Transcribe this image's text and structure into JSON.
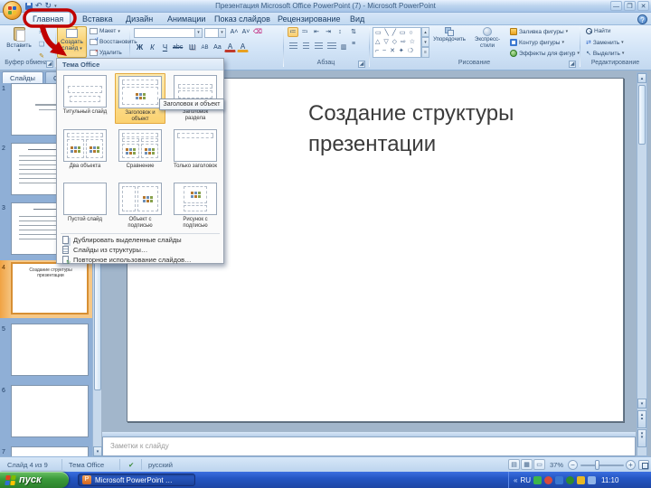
{
  "colors": {
    "annotation_red": "#c00000",
    "selection_orange": "#f0a344",
    "highlight_orange": "#fbd271",
    "taskbar_blue": "#2456c4",
    "start_green": "#3a9a3a"
  },
  "icons": {
    "caret": "▾",
    "scissors": "✂",
    "copy": "❏",
    "format_painter": "✎",
    "undo": "↶",
    "redo": "↻",
    "help": "?",
    "up": "▴",
    "down": "▾",
    "check": "✔",
    "minimize": "—",
    "maximize": "❐",
    "close": "✕",
    "chevron": "«",
    "minus": "−",
    "plus": "+"
  },
  "titlebar": {
    "title": "Презентация Microsoft Office PowerPoint (7) - Microsoft PowerPoint"
  },
  "tabs": {
    "home": "Главная",
    "insert": "Вставка",
    "design": "Дизайн",
    "animations": "Анимации",
    "slideshow": "Показ слайдов",
    "review": "Рецензирование",
    "view": "Вид"
  },
  "ribbon": {
    "paste": "Вставить",
    "clipboard_group": "Буфер обмена",
    "new_slide_1": "Создать",
    "new_slide_2": "слайд",
    "layout": "Макет",
    "reset": "Восстановить",
    "delete": "Удалить",
    "bold": "Ж",
    "italic": "К",
    "underline": "Ч",
    "strike": "abc",
    "shadow": "Ш",
    "spacing": "АВ",
    "case": "Аа",
    "fontcolor": "А",
    "paragraph_group": "Абзац",
    "shapes_row1": "▭ ╲ ╱ ▭ ○",
    "shapes_row2": "△ ▽ ◇ ⇨ ☆",
    "shapes_row3": "⌐ ~ ✕ ✦ ❍",
    "arrange": "Упорядочить",
    "quick_styles": "Экспресс-стили",
    "shape_fill": "Заливка фигуры",
    "shape_outline": "Контур фигуры",
    "shape_effects": "Эффекты для фигур",
    "drawing_group": "Рисование",
    "find": "Найти",
    "replace": "Заменить",
    "select": "Выделить",
    "editing_group": "Редактирование"
  },
  "layout_menu": {
    "header": "Тема Office",
    "tooltip": "Заголовок и объект",
    "layouts": [
      "Титульный слайд",
      "Заголовок и объект",
      "Заголовок раздела",
      "Два объекта",
      "Сравнение",
      "Только заголовок",
      "Пустой слайд",
      "Объект с подписью",
      "Рисунок с подписью"
    ],
    "duplicate": "Дублировать выделенные слайды",
    "from_outline": "Слайды из структуры…",
    "reuse": "Повторное использование слайдов…"
  },
  "slides_pane": {
    "tab_slides": "Слайды",
    "tab_outline": "Структура",
    "numbers": [
      "1",
      "2",
      "3",
      "4",
      "5",
      "6",
      "7"
    ],
    "slide4_text": "Создание структуры презентации"
  },
  "slide": {
    "title_line1": "Создание структуры",
    "title_line2": "презентации"
  },
  "notes": {
    "placeholder": "Заметки к слайду"
  },
  "statusbar": {
    "slide_info": "Слайд 4 из 9",
    "theme": "Тема Office",
    "language": "русский",
    "zoom": "37%"
  },
  "taskbar": {
    "start": "пуск",
    "task": "Microsoft PowerPoint …",
    "lang": "RU",
    "time": "11:10"
  }
}
